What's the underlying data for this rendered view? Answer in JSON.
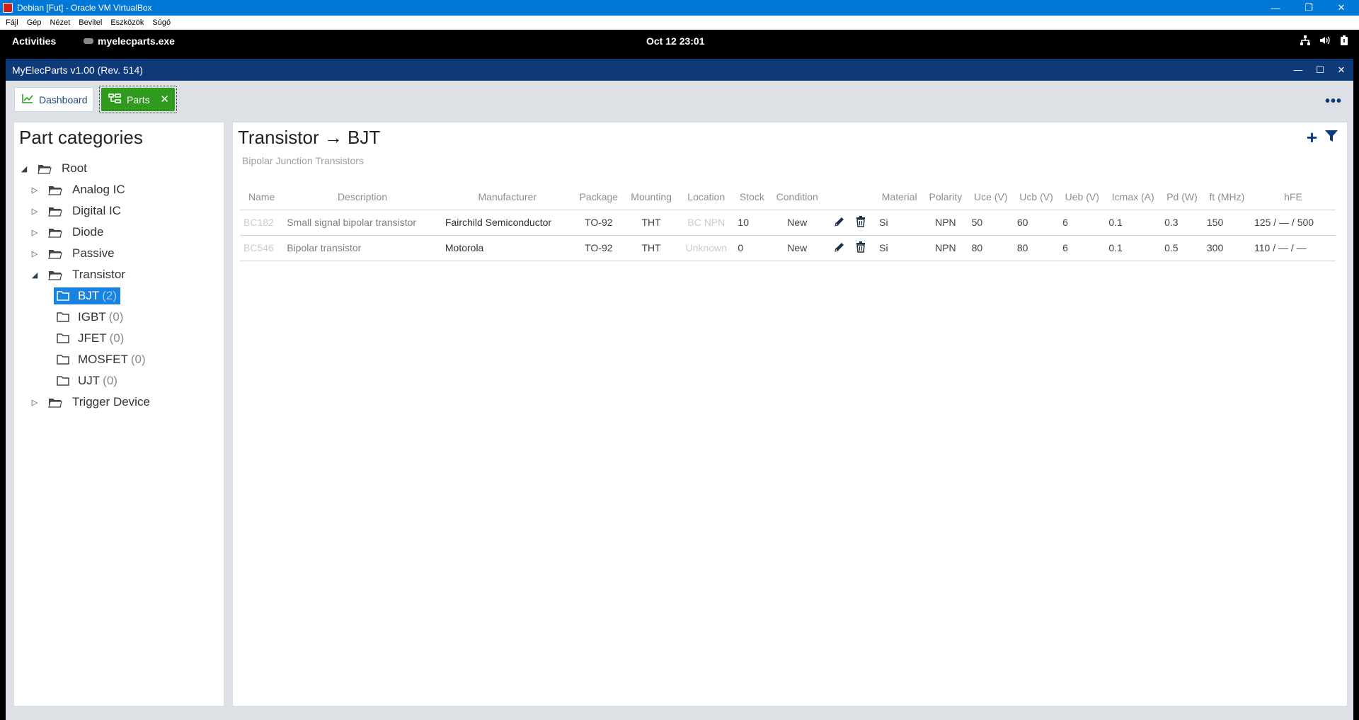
{
  "vbox": {
    "title": "Debian [Fut] - Oracle VM VirtualBox",
    "menu": [
      "Fájl",
      "Gép",
      "Nézet",
      "Bevitel",
      "Eszközök",
      "Súgó"
    ]
  },
  "gnome": {
    "activities": "Activities",
    "app_name": "myelecparts.exe",
    "clock": "Oct 12  23:01"
  },
  "app": {
    "title": "MyElecParts v1.00  (Rev. 514)",
    "tabs": {
      "dashboard": "Dashboard",
      "parts": "Parts"
    }
  },
  "categories": {
    "heading": "Part categories",
    "nodes": [
      {
        "label": "Root",
        "count": ""
      },
      {
        "label": "Analog IC",
        "count": ""
      },
      {
        "label": "Digital IC",
        "count": ""
      },
      {
        "label": "Diode",
        "count": ""
      },
      {
        "label": "Passive",
        "count": ""
      },
      {
        "label": "Transistor",
        "count": ""
      },
      {
        "label": "BJT",
        "count": "(2)"
      },
      {
        "label": "IGBT",
        "count": "(0)"
      },
      {
        "label": "JFET",
        "count": "(0)"
      },
      {
        "label": "MOSFET",
        "count": "(0)"
      },
      {
        "label": "UJT",
        "count": "(0)"
      },
      {
        "label": "Trigger Device",
        "count": ""
      }
    ]
  },
  "parts": {
    "title": "Transistor → BJT",
    "subtitle": "Bipolar Junction Transistors",
    "columns": [
      "Name",
      "Description",
      "Manufacturer",
      "Package",
      "Mounting",
      "Location",
      "Stock",
      "Condition",
      "",
      "Material",
      "Polarity",
      "Uce (V)",
      "Ucb (V)",
      "Ueb (V)",
      "Icmax (A)",
      "Pd (W)",
      "ft (MHz)",
      "hFE"
    ],
    "rows": [
      {
        "name": "BC182",
        "description": "Small signal bipolar transistor",
        "manufacturer": "Fairchild Semiconductor",
        "package": "TO-92",
        "mounting": "THT",
        "location": "BC NPN",
        "stock": "10",
        "condition": "New",
        "material": "Si",
        "polarity": "NPN",
        "uce": "50",
        "ucb": "60",
        "ueb": "6",
        "icmax": "0.1",
        "pd": "0.3",
        "ft": "150",
        "hfe": "125 / — / 500"
      },
      {
        "name": "BC546",
        "description": "Bipolar transistor",
        "manufacturer": "Motorola",
        "package": "TO-92",
        "mounting": "THT",
        "location": "Unknown",
        "stock": "0",
        "condition": "New",
        "material": "Si",
        "polarity": "NPN",
        "uce": "80",
        "ucb": "80",
        "ueb": "6",
        "icmax": "0.1",
        "pd": "0.5",
        "ft": "300",
        "hfe": "110 / — / —"
      }
    ]
  },
  "colors": {
    "vbox_title": "#0078d7",
    "app_title": "#0f3a7a",
    "parts_tab": "#2f9a1d",
    "selected": "#1a82e0"
  }
}
